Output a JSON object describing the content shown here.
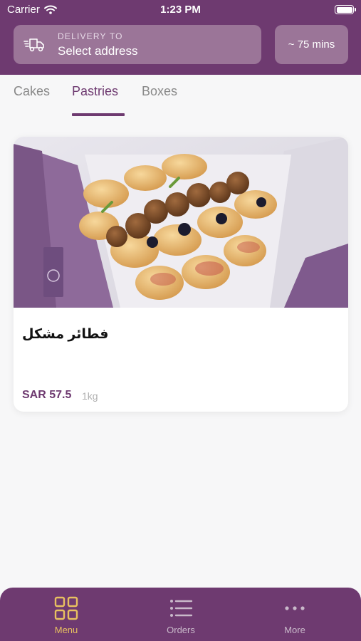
{
  "status_bar": {
    "carrier": "Carrier",
    "time": "1:23 PM"
  },
  "delivery": {
    "label": "DELIVERY TO",
    "address": "Select address"
  },
  "eta": "~ 75 mins",
  "tabs": [
    {
      "label": "Cakes",
      "active": false
    },
    {
      "label": "Pastries",
      "active": true
    },
    {
      "label": "Boxes",
      "active": false
    }
  ],
  "product": {
    "name": "فطائر مشكل",
    "price": "SAR 57.5",
    "weight": "1kg"
  },
  "bottom_nav": [
    {
      "label": "Menu",
      "icon": "grid-icon",
      "active": true
    },
    {
      "label": "Orders",
      "icon": "list-icon",
      "active": false
    },
    {
      "label": "More",
      "icon": "more-dots-icon",
      "active": false
    }
  ],
  "colors": {
    "brand": "#6e3a70",
    "accent": "#e8c060",
    "chip": "#9b7598"
  }
}
